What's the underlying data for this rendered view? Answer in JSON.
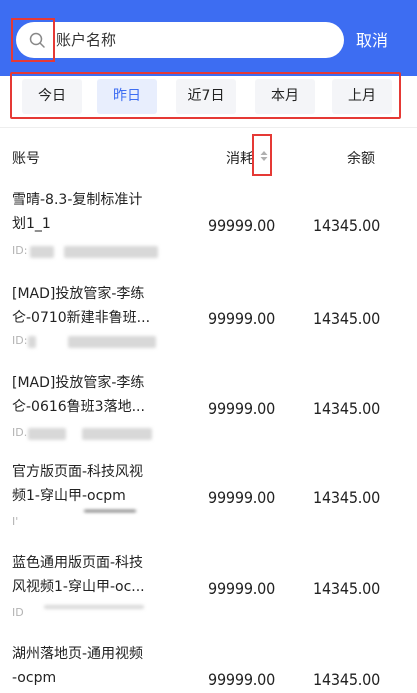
{
  "search": {
    "placeholder": "账户名称",
    "cancel_label": "取消"
  },
  "filters": [
    {
      "label": "今日",
      "active": false
    },
    {
      "label": "昨日",
      "active": true
    },
    {
      "label": "近7日",
      "active": false
    },
    {
      "label": "本月",
      "active": false
    },
    {
      "label": "上月",
      "active": false
    }
  ],
  "table": {
    "headers": {
      "account": "账号",
      "cost": "消耗",
      "balance": "余额"
    },
    "rows": [
      {
        "name_line1": "雪晴-8.3-复制标准计",
        "name_line2": "划1_1",
        "id_prefix": "ID:",
        "cost": "99999.00",
        "balance": "14345.00"
      },
      {
        "name_line1": "[MAD]投放管家-李练",
        "name_line2": "仑-0710新建非鲁班...",
        "id_prefix": "ID:",
        "cost": "99999.00",
        "balance": "14345.00"
      },
      {
        "name_line1": "[MAD]投放管家-李练",
        "name_line2": "仑-0616鲁班3落地...",
        "id_prefix": "ID.",
        "cost": "99999.00",
        "balance": "14345.00"
      },
      {
        "name_line1": "官方版页面-科技风视",
        "name_line2": "频1-穿山甲-ocpm",
        "id_prefix": "I'",
        "cost": "99999.00",
        "balance": "14345.00"
      },
      {
        "name_line1": "蓝色通用版页面-科技",
        "name_line2": "风视频1-穿山甲-oc...",
        "id_prefix": "ID",
        "cost": "99999.00",
        "balance": "14345.00"
      },
      {
        "name_line1": "湖州落地页-通用视频",
        "name_line2": "-ocpm",
        "id_prefix": "",
        "cost": "99999.00",
        "balance": "14345.00"
      }
    ]
  },
  "colors": {
    "brand": "#3d6df2",
    "highlight": "#e53935"
  },
  "icons": {
    "search": "search-icon",
    "sort": "sort-icon"
  }
}
